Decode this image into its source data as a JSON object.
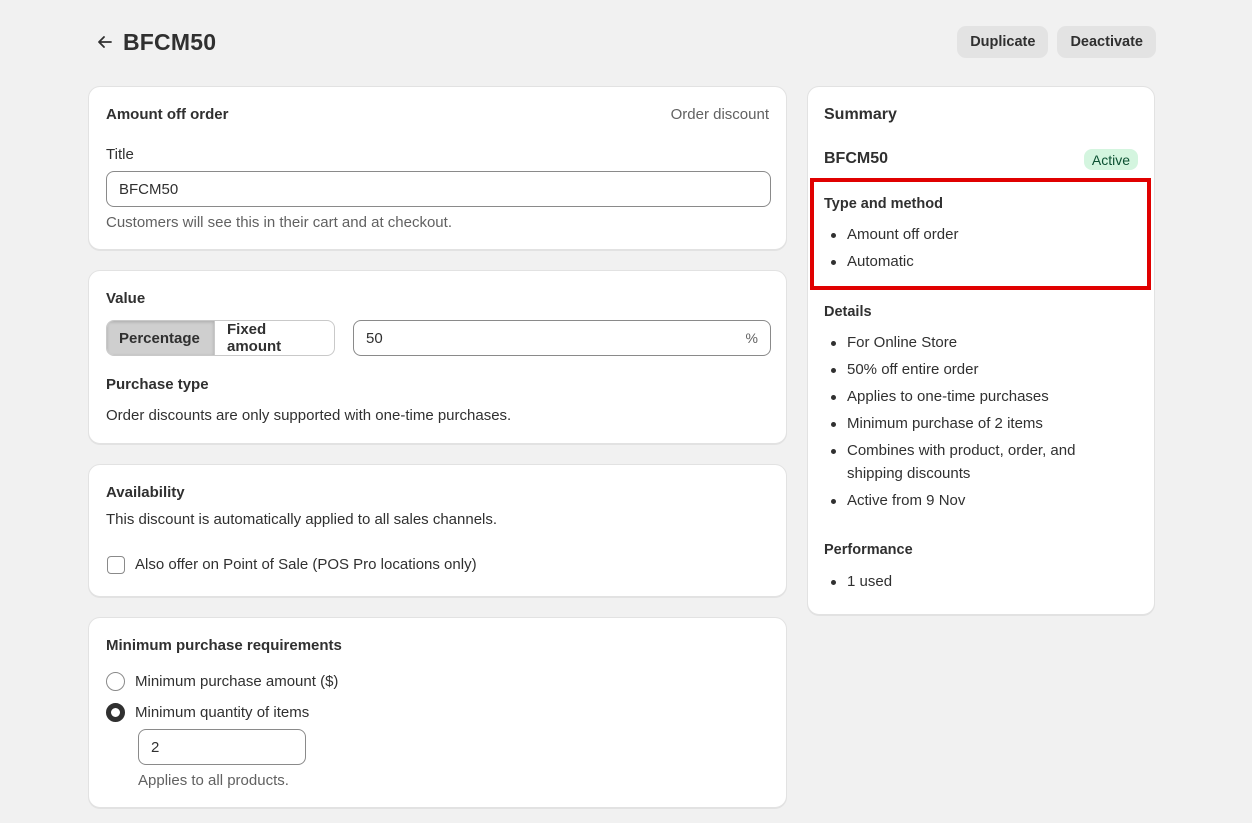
{
  "header": {
    "title": "BFCM50",
    "duplicate_label": "Duplicate",
    "deactivate_label": "Deactivate"
  },
  "discount_card": {
    "heading": "Amount off order",
    "type_label": "Order discount",
    "title_label": "Title",
    "title_value": "BFCM50",
    "title_help": "Customers will see this in their cart and at checkout."
  },
  "value_card": {
    "heading": "Value",
    "options": [
      "Percentage",
      "Fixed amount"
    ],
    "selected_option": "Percentage",
    "amount_value": "50",
    "amount_suffix": "%",
    "purchase_type_heading": "Purchase type",
    "purchase_type_text": "Order discounts are only supported with one-time purchases."
  },
  "availability_card": {
    "heading": "Availability",
    "description": "This discount is automatically applied to all sales channels.",
    "pos_label": "Also offer on Point of Sale (POS Pro locations only)",
    "pos_checked": false
  },
  "minimum_card": {
    "heading": "Minimum purchase requirements",
    "options": [
      "Minimum purchase amount ($)",
      "Minimum quantity of items"
    ],
    "selected_index": 1,
    "quantity_value": "2",
    "quantity_help": "Applies to all products."
  },
  "summary": {
    "heading": "Summary",
    "code": "BFCM50",
    "status": "Active",
    "type_heading": "Type and method",
    "type_items": [
      "Amount off order",
      "Automatic"
    ],
    "details_heading": "Details",
    "details_items": [
      "For Online Store",
      "50% off entire order",
      "Applies to one-time purchases",
      "Minimum purchase of 2 items",
      "Combines with product, order, and shipping discounts",
      "Active from 9 Nov"
    ],
    "performance_heading": "Performance",
    "performance_items": [
      "1 used"
    ]
  },
  "icons": {
    "back": "arrow-left-icon"
  },
  "colors": {
    "background": "#f1f1f1",
    "badge_bg": "#d4f5df",
    "badge_text": "#0c5132",
    "highlight": "#e00000"
  }
}
